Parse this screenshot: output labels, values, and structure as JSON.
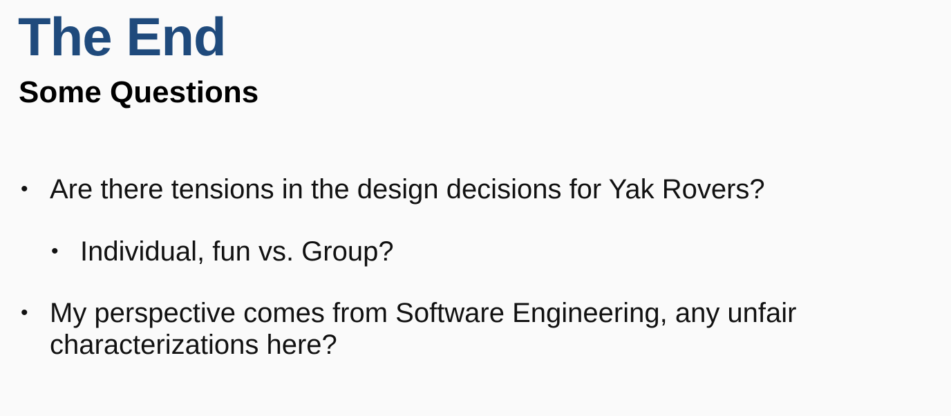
{
  "slide": {
    "title": "The End",
    "subtitle": "Some Questions",
    "bullet_symbol": "•",
    "bullets": [
      {
        "level": 1,
        "text": "Are there tensions in the design decisions for Yak Rovers?"
      },
      {
        "level": 2,
        "text": "Individual, fun vs. Group?"
      },
      {
        "level": 1,
        "text": "My perspective comes from Software Engineering, any unfair characterizations here?"
      }
    ]
  },
  "colors": {
    "title": "#1f4a7c",
    "background": "#fafafa",
    "text": "#111111"
  }
}
